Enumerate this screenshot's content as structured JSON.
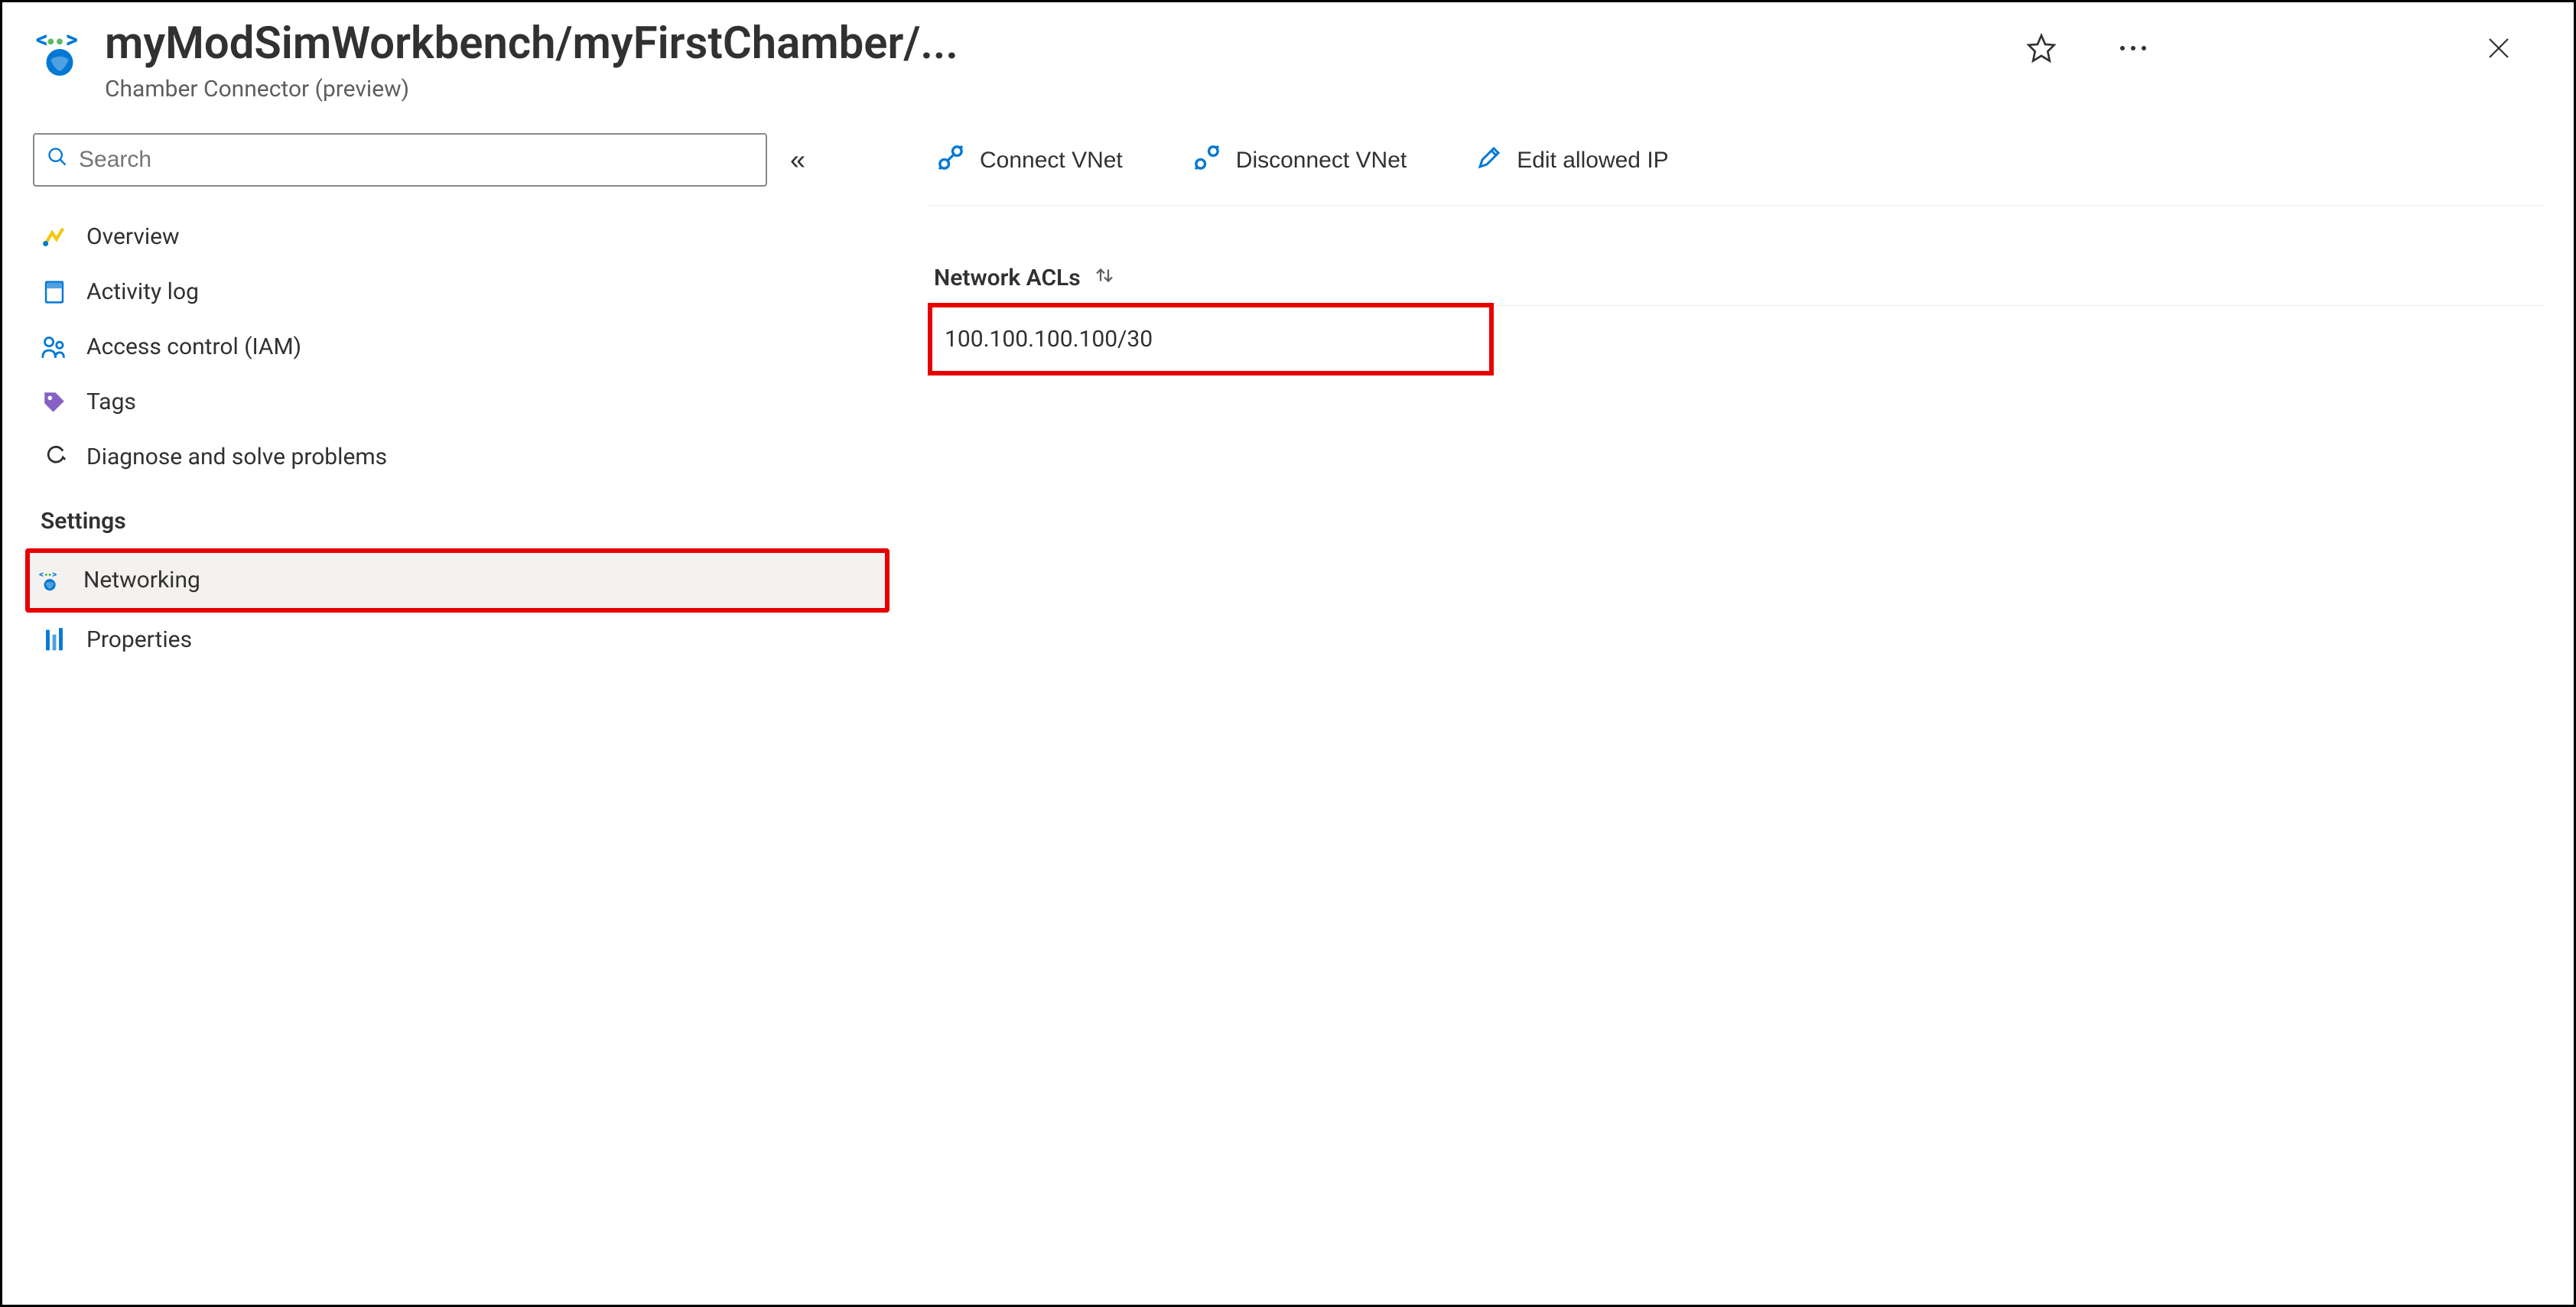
{
  "header": {
    "title": "myModSimWorkbench/myFirstChamber/...",
    "subtitle": "Chamber Connector (preview)"
  },
  "search": {
    "placeholder": "Search"
  },
  "sidebar": {
    "items": [
      {
        "label": "Overview"
      },
      {
        "label": "Activity log"
      },
      {
        "label": "Access control (IAM)"
      },
      {
        "label": "Tags"
      },
      {
        "label": "Diagnose and solve problems"
      }
    ],
    "settings_label": "Settings",
    "settings_items": [
      {
        "label": "Networking"
      },
      {
        "label": "Properties"
      }
    ]
  },
  "toolbar": {
    "connect": "Connect VNet",
    "disconnect": "Disconnect VNet",
    "edit_ip": "Edit allowed IP"
  },
  "main": {
    "column_header": "Network ACLs",
    "acl_value": "100.100.100.100/30"
  }
}
